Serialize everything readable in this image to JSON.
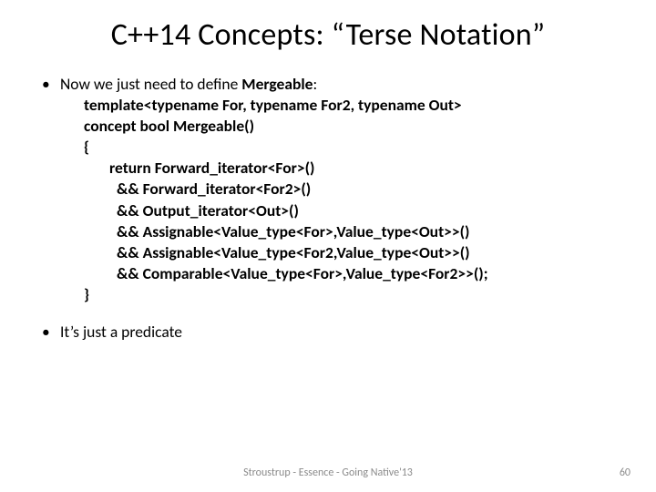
{
  "title": "C++14 Concepts: “Terse Notation”",
  "bullets": {
    "b1_prefix": "Now we just need to define ",
    "b1_bold": "Mergeable",
    "b1_suffix": ":",
    "b2": "It’s just a predicate"
  },
  "code": {
    "l1": "template<typename For, typename For2, typename Out>",
    "l2": "concept bool Mergeable()",
    "l3": "{",
    "l4_kw": "return",
    "l4_rest": " Forward_iterator<For>()",
    "l5": "&& Forward_iterator<For2>()",
    "l6": "&& Output_iterator<Out>()",
    "l7": "&& Assignable<Value_type<For>,Value_type<Out>>()",
    "l8": "&& Assignable<Value_type<For2,Value_type<Out>>()",
    "l9": "&& Comparable<Value_type<For>,Value_type<For2>>();",
    "l10": "}"
  },
  "footer": {
    "center": "Stroustrup - Essence - Going Native'13",
    "page": "60"
  }
}
